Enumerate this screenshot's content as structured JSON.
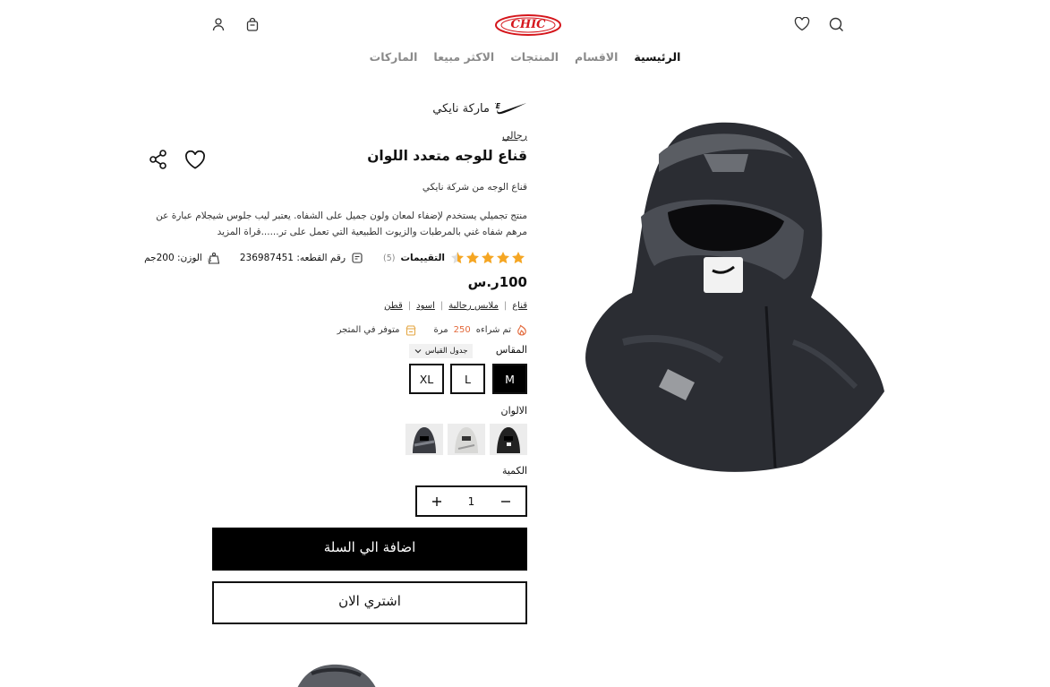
{
  "header": {
    "logo_text": "CHIC",
    "icons": [
      "user-icon",
      "bag-icon",
      "heart-icon",
      "search-icon"
    ]
  },
  "nav": {
    "items": [
      "الرئيسية",
      "الاقسام",
      "المنتجات",
      "الاكثر مبيعا",
      "الماركات"
    ]
  },
  "product": {
    "brand_label": "ماركة نايكي",
    "brand_logo_alt": "NIKE",
    "category_link": "رجالي",
    "title": "قناع للوجه متعدد اللوان",
    "subtitle": "قناع الوجه من شركة نايكي",
    "description": "منتج تجميلي يستخدم لإضفاء لمعان ولون جميل على الشفاه. يعتبر ليب جلوس شيجلام عبارة عن مرهم شفاه غني بالمرطبات والزيوت الطبيعية التي تعمل على تر......قراة المزيد",
    "rating": 4.5,
    "ratings_label": "التقييمات",
    "ratings_count": "(5)",
    "piece_number_label": "رقم القطعه: 236987451",
    "weight_label": "الوزن: 200جم",
    "price": "100ر.س",
    "tags": [
      "قناع",
      "ملابس رجالية",
      "اسود",
      "قطن"
    ],
    "purchased_prefix": "تم شراءه",
    "purchased_count": "250",
    "purchased_suffix": "مرة",
    "stock_status": "متوفر في المتجر",
    "size_label": "المقاس",
    "size_guide_label": "جدول القياس",
    "sizes": [
      "M",
      "L",
      "XL"
    ],
    "selected_size": "M",
    "colors_label": "الالوان",
    "color_swatches": [
      "black",
      "white",
      "grey"
    ],
    "quantity_label": "الكمية",
    "quantity": "1",
    "add_to_cart": "اضافة الي السلة",
    "buy_now": "اشتري الان"
  },
  "colors": {
    "accent": "#e36a3c",
    "primary": "#000000",
    "logo_red": "#d5161c",
    "star": "#f5a623"
  }
}
